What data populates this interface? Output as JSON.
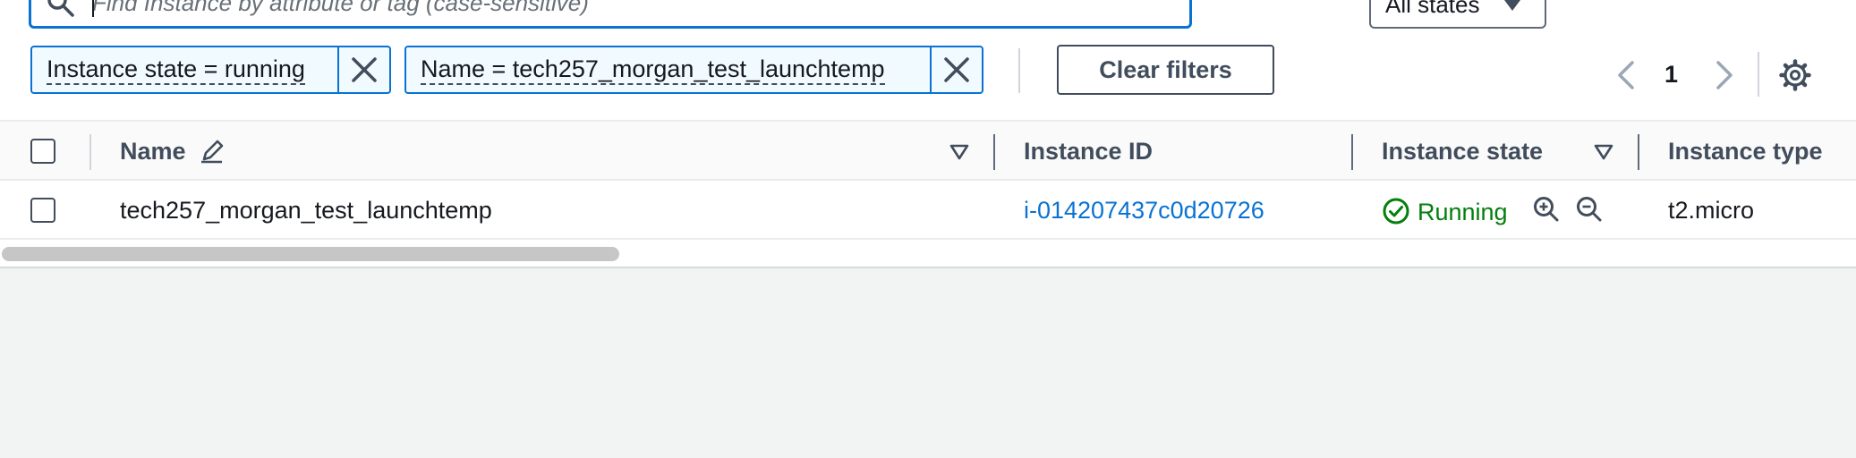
{
  "search": {
    "placeholder": "Find Instance by attribute or tag (case-sensitive)",
    "value": ""
  },
  "states_filter": {
    "selected": "All states"
  },
  "filters": [
    {
      "label": "Instance state = running"
    },
    {
      "label": "Name = tech257_morgan_test_launchtemp"
    }
  ],
  "clear_filters_label": "Clear filters",
  "pagination": {
    "current_page": "1"
  },
  "table": {
    "columns": [
      "Name",
      "Instance ID",
      "Instance state",
      "Instance type"
    ],
    "rows": [
      {
        "name": "tech257_morgan_test_launchtemp",
        "instance_id": "i-014207437c0d20726",
        "state": "Running",
        "type": "t2.micro"
      }
    ]
  },
  "colors": {
    "accent": "#0972d3",
    "running": "#037f0c",
    "background": "#f2f3f3"
  },
  "icons": [
    "search-icon",
    "caret-down-icon",
    "close-icon",
    "chevron-left-icon",
    "chevron-right-icon",
    "gear-icon",
    "pencil-icon",
    "sort-caret-icon",
    "check-circle-icon",
    "zoom-in-icon",
    "zoom-out-icon"
  ]
}
